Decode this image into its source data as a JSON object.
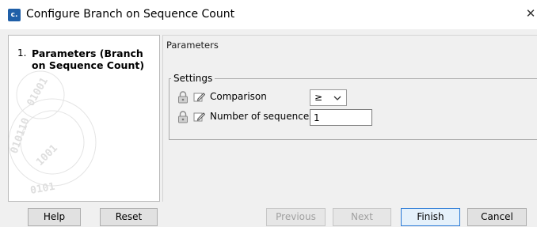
{
  "window": {
    "title": "Configure Branch on Sequence Count",
    "icon": "clc-app-icon",
    "icon_glyph": "c."
  },
  "wizard_steps": [
    {
      "number": "1.",
      "label": "Parameters (Branch on Sequence Count)"
    }
  ],
  "panel": {
    "title": "Parameters",
    "group_title": "Settings",
    "fields": [
      {
        "label": "Comparison",
        "type": "select",
        "value": "≥",
        "locked": true
      },
      {
        "label": "Number of sequences",
        "type": "text",
        "value": "1",
        "locked": true
      }
    ]
  },
  "buttons": {
    "help": "Help",
    "reset": "Reset",
    "previous": "Previous",
    "next": "Next",
    "finish": "Finish",
    "cancel": "Cancel"
  },
  "colors": {
    "app_icon": "#1f5fa8",
    "finish_border": "#2a7ad6"
  }
}
